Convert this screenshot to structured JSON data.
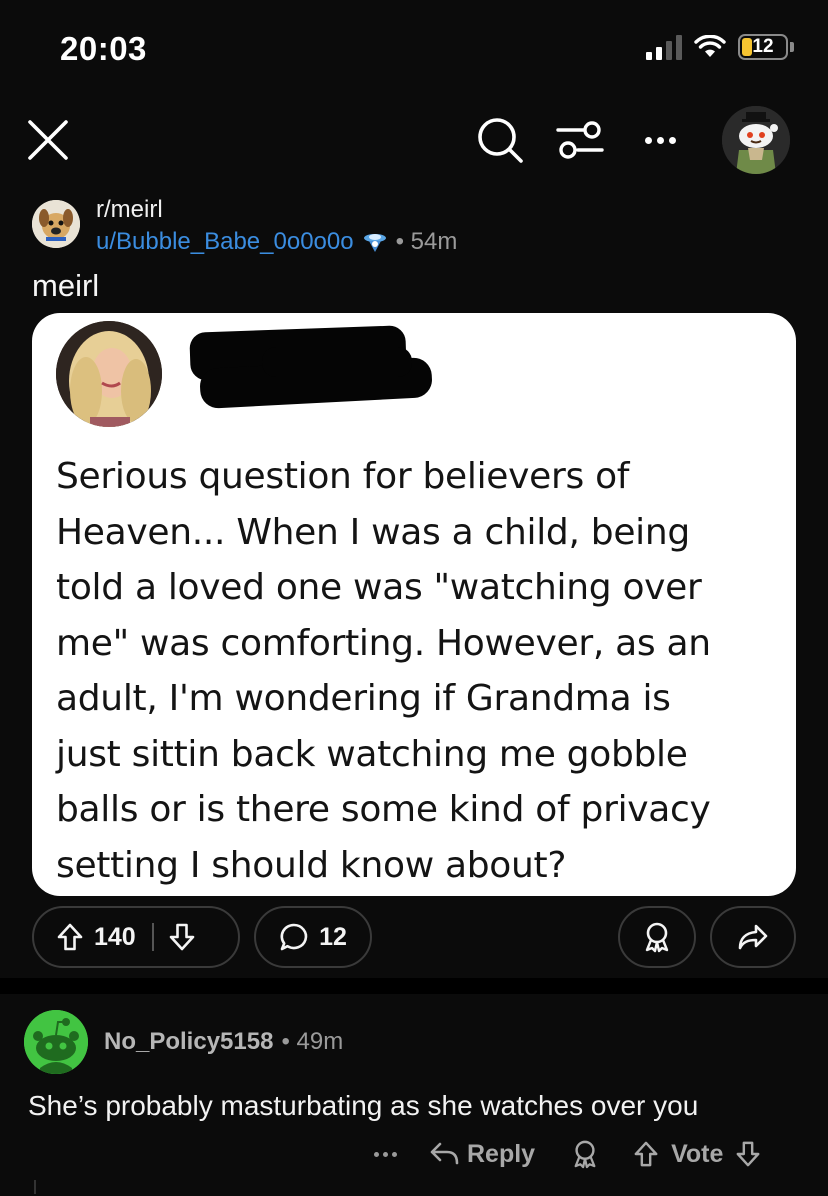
{
  "status_bar": {
    "time": "20:03",
    "battery_level": "12",
    "icons": [
      "signal-icon",
      "wifi-icon",
      "battery-icon"
    ]
  },
  "nav": {
    "icons": [
      "close-icon",
      "search-icon",
      "filter-icon",
      "more-icon",
      "avatar"
    ]
  },
  "post": {
    "subreddit": "r/meirl",
    "author": "u/Bubble_Babe_0o0o0o",
    "time": "• 54m",
    "title": "meirl",
    "image_text_lines": [
      "Serious question for believers of",
      "Heaven... When I was a child, being",
      "told a loved one was \"watching over",
      "me\" was comforting. However, as an",
      "adult, I'm wondering if Grandma is",
      "just sittin back watching me gobble",
      "balls or is there some kind of privacy",
      "setting I should know about?"
    ],
    "upvotes": "140",
    "comments": "12"
  },
  "comment": {
    "author": "No_Policy5158",
    "time": "• 49m",
    "body": "She’s probably masturbating as she watches over you",
    "reply_label": "Reply",
    "vote_label": "Vote"
  },
  "colors": {
    "background": "#0b0b0b",
    "author_link": "#3b8de0",
    "muted": "#9a9a9a",
    "pill_border": "#3a3a3a",
    "battery": "#f6c431"
  }
}
